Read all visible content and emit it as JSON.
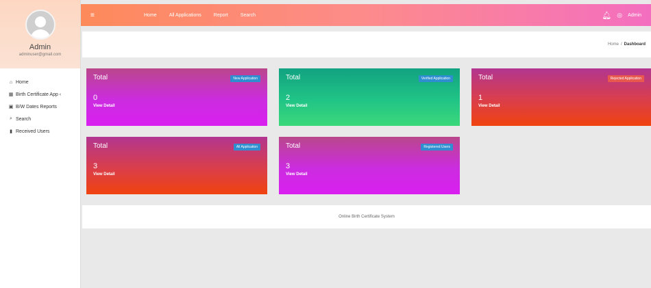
{
  "sidebar": {
    "profile": {
      "name": "Admin",
      "email": "adminuser@gmail.com"
    },
    "items": [
      {
        "icon": "home-icon",
        "glyph": "⌂",
        "label": "Home"
      },
      {
        "icon": "certificate-icon",
        "glyph": "▦",
        "label": "Birth Certificate App ‹"
      },
      {
        "icon": "calendar-icon",
        "glyph": "▣",
        "label": "B/W Dates Reports"
      },
      {
        "icon": "search-icon",
        "glyph": "⌕",
        "label": "Search"
      },
      {
        "icon": "users-icon",
        "glyph": "▮",
        "label": "Received Users"
      }
    ]
  },
  "topbar": {
    "menu_glyph": "≡",
    "nav": [
      "Home",
      "All Applications",
      "Report",
      "Search"
    ],
    "user_label": "Admin"
  },
  "breadcrumb": {
    "home": "Home",
    "separator": "/",
    "current": "Dashboard"
  },
  "cards": [
    {
      "title": "Total",
      "badge": "New Application",
      "count": "0",
      "detail": "View Detail"
    },
    {
      "title": "Total",
      "badge": "Verified Application",
      "count": "2",
      "detail": "View Detail"
    },
    {
      "title": "Total",
      "badge": "Rejected Application",
      "count": "1",
      "detail": "View Detail"
    },
    {
      "title": "Total",
      "badge": "All Application",
      "count": "3",
      "detail": "View Detail"
    },
    {
      "title": "Total",
      "badge": "Registered Users",
      "count": "3",
      "detail": "View Detail"
    }
  ],
  "footer": {
    "text": "Online Birth Certificate System"
  },
  "colors": {
    "topbar_start": "#fd8a5a",
    "topbar_end": "#f46ec0",
    "badge_blue": "#2e8ecf",
    "badge_red": "#e8584e"
  }
}
